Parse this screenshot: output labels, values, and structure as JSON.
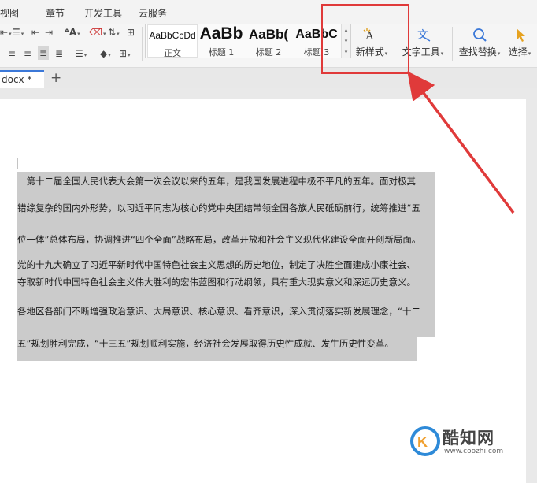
{
  "menubar": {
    "items": [
      "视图",
      "章节",
      "开发工具",
      "云服务"
    ]
  },
  "ribbon": {
    "styles": [
      {
        "sample": "AaBbCcDd",
        "name": "正文"
      },
      {
        "sample": "AaBb",
        "name": "标题 1"
      },
      {
        "sample": "AaBb(",
        "name": "标题 2"
      },
      {
        "sample": "AaBbC",
        "name": "标题 3"
      }
    ],
    "new_style_label": "新样式",
    "text_tools_label": "文字工具",
    "find_replace_label": "查找替换",
    "select_label": "选择"
  },
  "tabbar": {
    "doc_tab_label": "docx *",
    "add_tab_label": "+"
  },
  "document": {
    "lines": [
      "　第十二届全国人民代表大会第一次会议以来的五年，是我国发展进程中极不平凡的五年。面对极其",
      "错综复杂的国内外形势，以习近平同志为核心的党中央团结带领全国各族人民砥砺前行，统筹推进“五",
      "位一体”总体布局，协调推进“四个全面”战略布局，改革开放和社会主义现代化建设全面开创新局面。",
      "党的十九大确立了习近平新时代中国特色社会主义思想的历史地位，制定了决胜全面建成小康社会、",
      "夺取新时代中国特色社会主义伟大胜利的宏伟蓝图和行动纲领，具有重大现实意义和深远历史意义。",
      "各地区各部门不断增强政治意识、大局意识、核心意识、看齐意识，深入贯彻落实新发展理念，“十二",
      "五”规划胜利完成，“十三五”规划顺利实施，经济社会发展取得历史性成就、发生历史性变革。"
    ]
  },
  "watermark": {
    "brand": "酷知网",
    "url": "www.coozhi.com"
  },
  "colors": {
    "annotation_red": "#e03a3a",
    "selection_gray": "#cbcbcb",
    "tab_accent": "#3b78d8"
  }
}
